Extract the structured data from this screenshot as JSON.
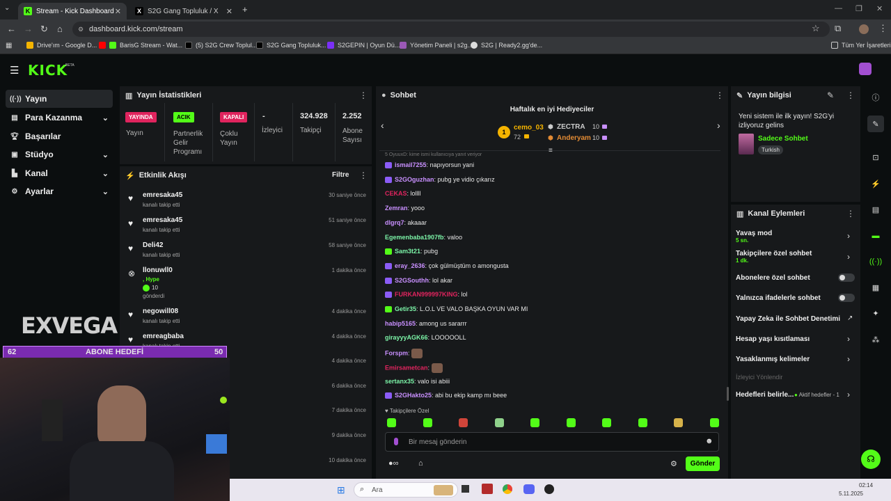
{
  "browser": {
    "tabs": [
      {
        "label": "Stream - Kick Dashboard",
        "active": true
      },
      {
        "label": "S2G Gang Topluluk / X",
        "active": false
      }
    ],
    "url": "dashboard.kick.com/stream",
    "bookmarks": [
      "Drive'ım - Google D...",
      "BarisG Stream - Wat...",
      "(5) S2G Crew Toplul...",
      "S2G Gang Topluluk...",
      "S2GEPIN | Oyun Dü...",
      "Yönetim Paneli | s2g...",
      "S2G | Ready2.gg'de..."
    ],
    "all_bookmarks": "Tüm Yer İşaretleri"
  },
  "brand": {
    "logo": "KICK",
    "beta": "BETA",
    "accent": "#53fc18"
  },
  "sidebar": {
    "items": [
      {
        "label": "Yayın",
        "icon": "radio-icon",
        "active": true,
        "expandable": false
      },
      {
        "label": "Para Kazanma",
        "icon": "money-icon",
        "active": false,
        "expandable": true
      },
      {
        "label": "Başarılar",
        "icon": "trophy-icon",
        "active": false,
        "expandable": false
      },
      {
        "label": "Stüdyo",
        "icon": "studio-icon",
        "active": false,
        "expandable": true
      },
      {
        "label": "Kanal",
        "icon": "channel-icon",
        "active": false,
        "expandable": true
      },
      {
        "label": "Ayarlar",
        "icon": "gear-icon",
        "active": false,
        "expandable": true
      }
    ]
  },
  "stats": {
    "title": "Yayın İstatistikleri",
    "cols": [
      {
        "badge": "YAYINDA",
        "badge_color": "#e0245e",
        "label": "Yayın"
      },
      {
        "badge": "ACIK",
        "badge_color": "#53fc18",
        "label": "Partnerlik Gelir Programı"
      },
      {
        "badge": "KAPALI",
        "badge_color": "#e0245e",
        "label": "Çoklu Yayın"
      },
      {
        "value": "-",
        "label": "İzleyici"
      },
      {
        "value": "324.928",
        "label": "Takipçi"
      },
      {
        "value": "2.252",
        "label": "Abone Sayısı"
      }
    ]
  },
  "activity": {
    "title": "Etkinlik Akışı",
    "filter": "Filtre",
    "items": [
      {
        "name": "emresaka45",
        "sub": "kanalı takip etti",
        "time": "30 saniye önce",
        "icon": "heart-icon"
      },
      {
        "name": "emresaka45",
        "sub": "kanalı takip etti",
        "time": "51 saniye önce",
        "icon": "heart-icon"
      },
      {
        "name": "Deli42",
        "sub": "kanalı takip etti",
        "time": "58 saniye önce",
        "icon": "heart-icon"
      },
      {
        "name": "llonuwll0",
        "sub_extra": ", Hype",
        "kicks": "10",
        "sub": "gönderdi",
        "time": "1 dakika önce",
        "icon": "kick-icon"
      },
      {
        "name": "negowill08",
        "sub": "kanalı takip etti",
        "time": "4 dakika önce",
        "icon": "heart-icon"
      },
      {
        "name": "emreagbaba",
        "sub": "kanalı takip etti",
        "time": "4 dakika önce",
        "icon": "heart-icon"
      },
      {
        "name": "",
        "sub": "",
        "time": "4 dakika önce"
      },
      {
        "name": "",
        "sub": "",
        "time": "6 dakika önce"
      },
      {
        "name": "",
        "sub": "",
        "time": "7 dakika önce"
      },
      {
        "name": "",
        "sub": "",
        "time": "9 dakika önce"
      },
      {
        "name": "",
        "sub": "",
        "time": "10 dakika önce"
      }
    ]
  },
  "chat": {
    "title": "Sohbet",
    "gifters_title": "Haftalık en iyi Hediyeciler",
    "gifters": [
      {
        "rank": "1",
        "name": "cemo_03",
        "amount": "72"
      },
      {
        "name": "ZECTRA",
        "amount": "10"
      },
      {
        "name": "Anderyam",
        "amount": "10"
      }
    ],
    "pinned_hint": "5 OyuuxD: kime ismi kullanıcıya yanıt veriyor",
    "messages": [
      {
        "user": "ismail7255",
        "color": "#c990ff",
        "text": "napıyorsun yani",
        "badge": true
      },
      {
        "user": "S2GOguzhan",
        "color": "#c990ff",
        "text": "pubg ye vidio çıkarız",
        "badge": true
      },
      {
        "user": "CEKAS",
        "color": "#e0245e",
        "text": "lollll",
        "badge": false
      },
      {
        "user": "Zemran",
        "color": "#c990ff",
        "text": "yooo",
        "badge": false
      },
      {
        "user": "dlgrq7",
        "color": "#c990ff",
        "text": "akaaar",
        "badge": false
      },
      {
        "user": "Egemenbaba1907fb",
        "color": "#7cf5a8",
        "text": "valoo",
        "badge": false
      },
      {
        "user": "Sam3t21",
        "color": "#7cf5a8",
        "text": "pubg",
        "badge": true
      },
      {
        "user": "eray_2636",
        "color": "#c990ff",
        "text": "çok gülmüştüm o amongusta",
        "badge": true
      },
      {
        "user": "S2GSouthh",
        "color": "#c990ff",
        "text": "lol akar",
        "badge": true
      },
      {
        "user": "FURKAN999997KING",
        "color": "#e0245e",
        "text": "lol",
        "badge": true
      },
      {
        "user": "Getir35",
        "color": "#7cf5a8",
        "text": "L.O.L VE VALO BAŞKA OYUN VAR MI",
        "badge": true
      },
      {
        "user": "habip5165",
        "color": "#c990ff",
        "text": "among us sararrr",
        "badge": false
      },
      {
        "user": "girayyyAGK66",
        "color": "#7cf5a8",
        "text": "LOOOOOLL",
        "badge": false
      },
      {
        "user": "Forspm",
        "color": "#c990ff",
        "text": "",
        "badge": false
      },
      {
        "user": "Emirsametcan",
        "color": "#e0245e",
        "text": "",
        "badge": false
      },
      {
        "user": "sertanx35",
        "color": "#7cf5a8",
        "text": "valo isi abiii",
        "badge": false
      },
      {
        "user": "S2GHakto25",
        "color": "#c990ff",
        "text": "abi bu ekip kamp mı beee",
        "badge": true
      }
    ],
    "followers_only": "Takipçilere Özel",
    "input_placeholder": "Bir mesaj gönderin",
    "send": "Gönder"
  },
  "stream_info": {
    "title": "Yayın bilgisi",
    "stream_title": "Yeni sistem ile ilk yayın! S2G'yi izliyoruz gelins",
    "category": "Sadece Sohbet",
    "language": "Turkish"
  },
  "channel_actions": {
    "title": "Kanal Eylemleri",
    "items": [
      {
        "label": "Yavaş mod",
        "sub": "5 sn.",
        "type": "chevron"
      },
      {
        "label": "Takipçilere özel sohbet",
        "sub": "1 dk.",
        "type": "chevron"
      },
      {
        "label": "Abonelere özel sohbet",
        "type": "toggle"
      },
      {
        "label": "Yalnızca ifadelerle sohbet",
        "type": "toggle"
      },
      {
        "label": "Yapay Zeka ile Sohbet Denetimi",
        "type": "external"
      },
      {
        "label": "Hesap yaşı kısıtlaması",
        "type": "chevron"
      },
      {
        "label": "Yasaklanmış kelimeler",
        "type": "chevron"
      }
    ],
    "section_viewer": "İzleyici Yönlendir",
    "goals_label": "Hedefleri belirle...",
    "goals_status": "Aktif hedefler - 1"
  },
  "overlay": {
    "watermark": "EXVEGA",
    "goal_left": "62",
    "goal_title": "ABONE HEDEFİ",
    "goal_right": "50"
  },
  "taskbar": {
    "search": "Ara",
    "time": "02:14",
    "date": "5.11.2025"
  }
}
